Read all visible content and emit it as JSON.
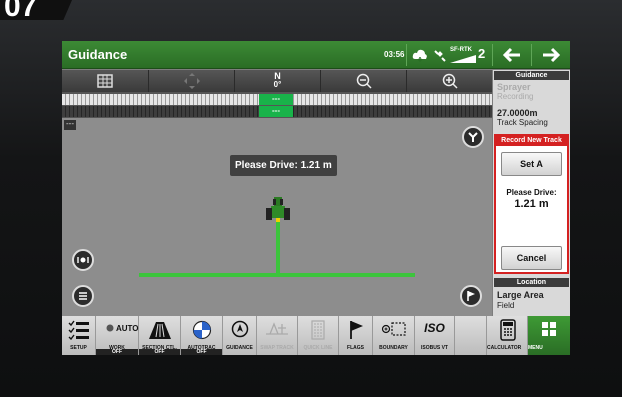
{
  "corner_badge": "07",
  "header": {
    "title": "Guidance",
    "time": "03:56",
    "gps_label": "SF-RTK",
    "gps_count": "2",
    "back_icon": "arrow-left-icon",
    "forward_icon": "arrow-right-icon",
    "accent_color": "#367d2f"
  },
  "map_toolbar": {
    "compass_heading": "N",
    "compass_degrees": "0°"
  },
  "lightbar": {
    "center_top": "---",
    "center_bottom": "---",
    "active_color": "#19b34a"
  },
  "map": {
    "corner_label": "---",
    "tooltip": "Please Drive: 1.21 m",
    "track_color": "#3cc43c"
  },
  "panel": {
    "guidance_header": "Guidance",
    "implement_name": "Sprayer",
    "implement_status": "Recording",
    "track_spacing_value": "27.0000m",
    "track_spacing_label": "Track Spacing",
    "record_header": "Record New Track",
    "set_a_label": "Set A",
    "please_drive_label": "Please Drive:",
    "please_drive_value": "1.21 m",
    "cancel_label": "Cancel",
    "location_header": "Location",
    "location_name": "Large Area",
    "location_sub": "Field"
  },
  "dock": {
    "setup": "SETUP",
    "work_auto": "AUTO",
    "work": "WORK",
    "work_state": "OFF",
    "section_ctl": "SECTION CTL.",
    "section_state": "OFF",
    "autotrac": "AUTOTRAC",
    "autotrac_state": "OFF",
    "guidance": "GUIDANCE",
    "swap_track": "SWAP TRACK",
    "quick_line": "QUICK LINE",
    "flags": "FLAGS",
    "boundary": "BOUNDARY",
    "isobus": "ISOBUS VT",
    "isobus_icon_text": "ISO",
    "calculator": "CALCULATOR",
    "menu": "MENU"
  }
}
